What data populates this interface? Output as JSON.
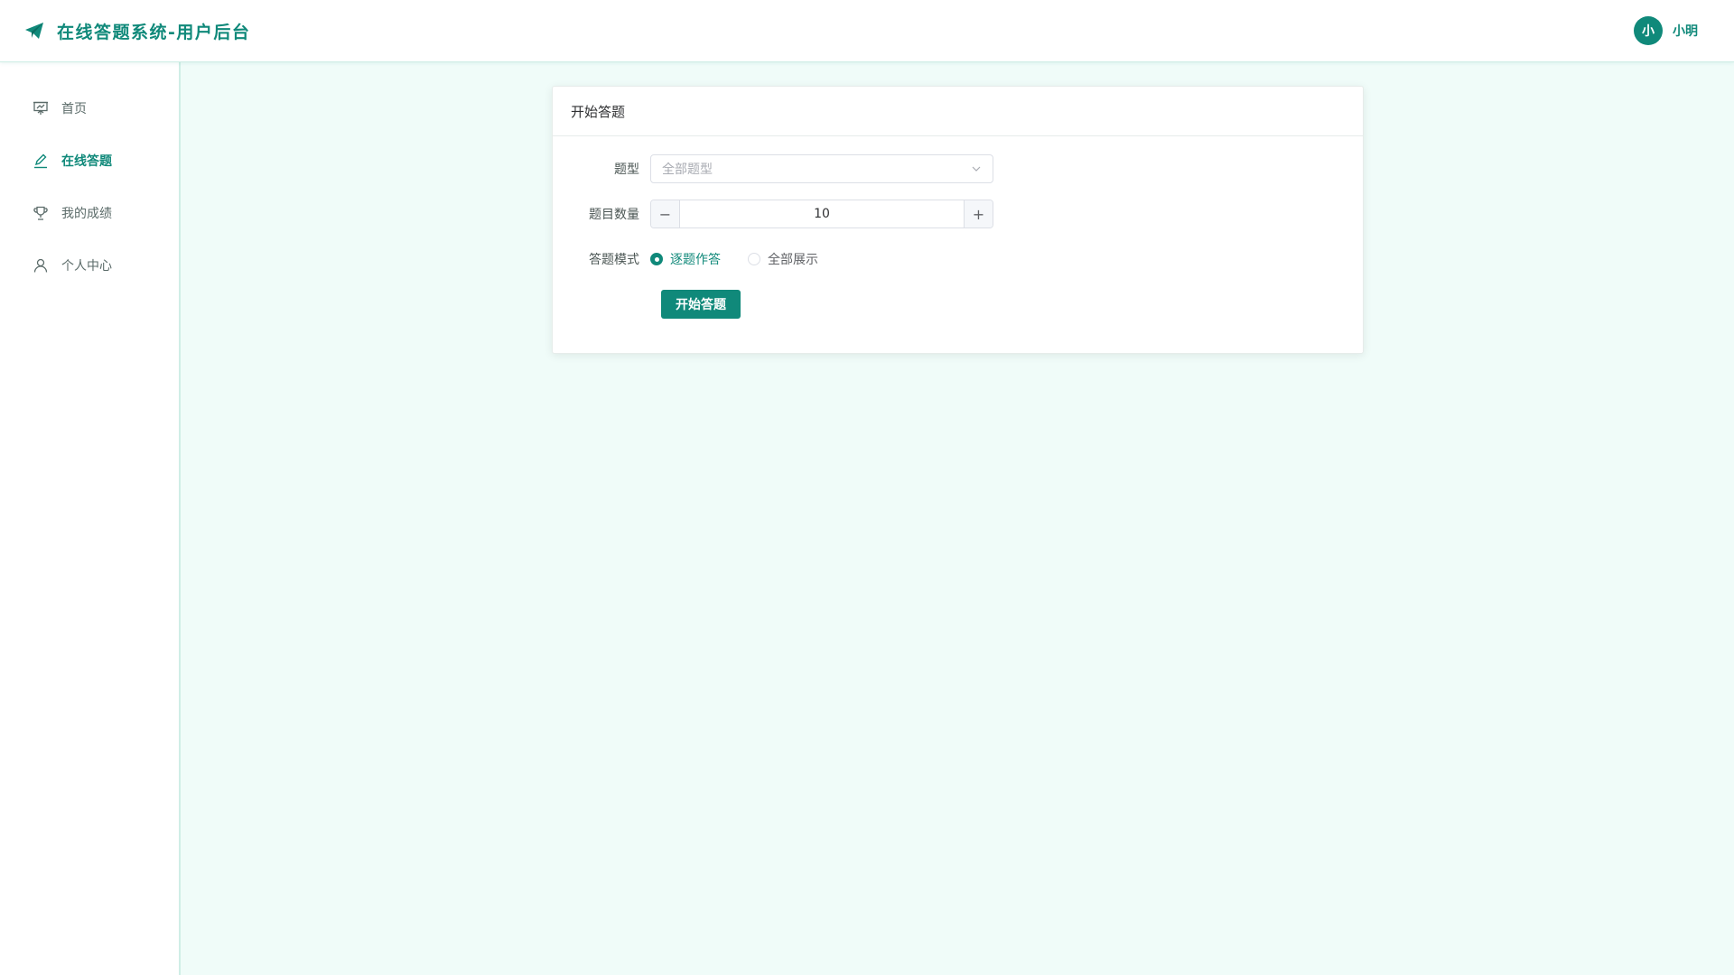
{
  "header": {
    "brand_icon": "paper-plane-icon",
    "title": "在线答题系统-用户后台",
    "user": {
      "avatar_text": "小",
      "name": "小明"
    }
  },
  "sidebar": {
    "items": [
      {
        "label": "首页",
        "icon": "presentation-board-icon",
        "active": false
      },
      {
        "label": "在线答题",
        "icon": "edit-pen-icon",
        "active": true
      },
      {
        "label": "我的成绩",
        "icon": "trophy-icon",
        "active": false
      },
      {
        "label": "个人中心",
        "icon": "user-icon",
        "active": false
      }
    ]
  },
  "card": {
    "title": "开始答题",
    "question_type": {
      "label": "题型",
      "placeholder": "全部题型"
    },
    "question_count": {
      "label": "题目数量",
      "value": "10",
      "minus": "−",
      "plus": "+"
    },
    "answer_mode": {
      "label": "答题模式",
      "options": [
        {
          "label": "逐题作答",
          "checked": true
        },
        {
          "label": "全部展示",
          "checked": false
        }
      ]
    },
    "start_button": "开始答题"
  },
  "colors": {
    "accent": "#10897a",
    "background": "#f0fcf9",
    "border": "#cfeee6"
  }
}
